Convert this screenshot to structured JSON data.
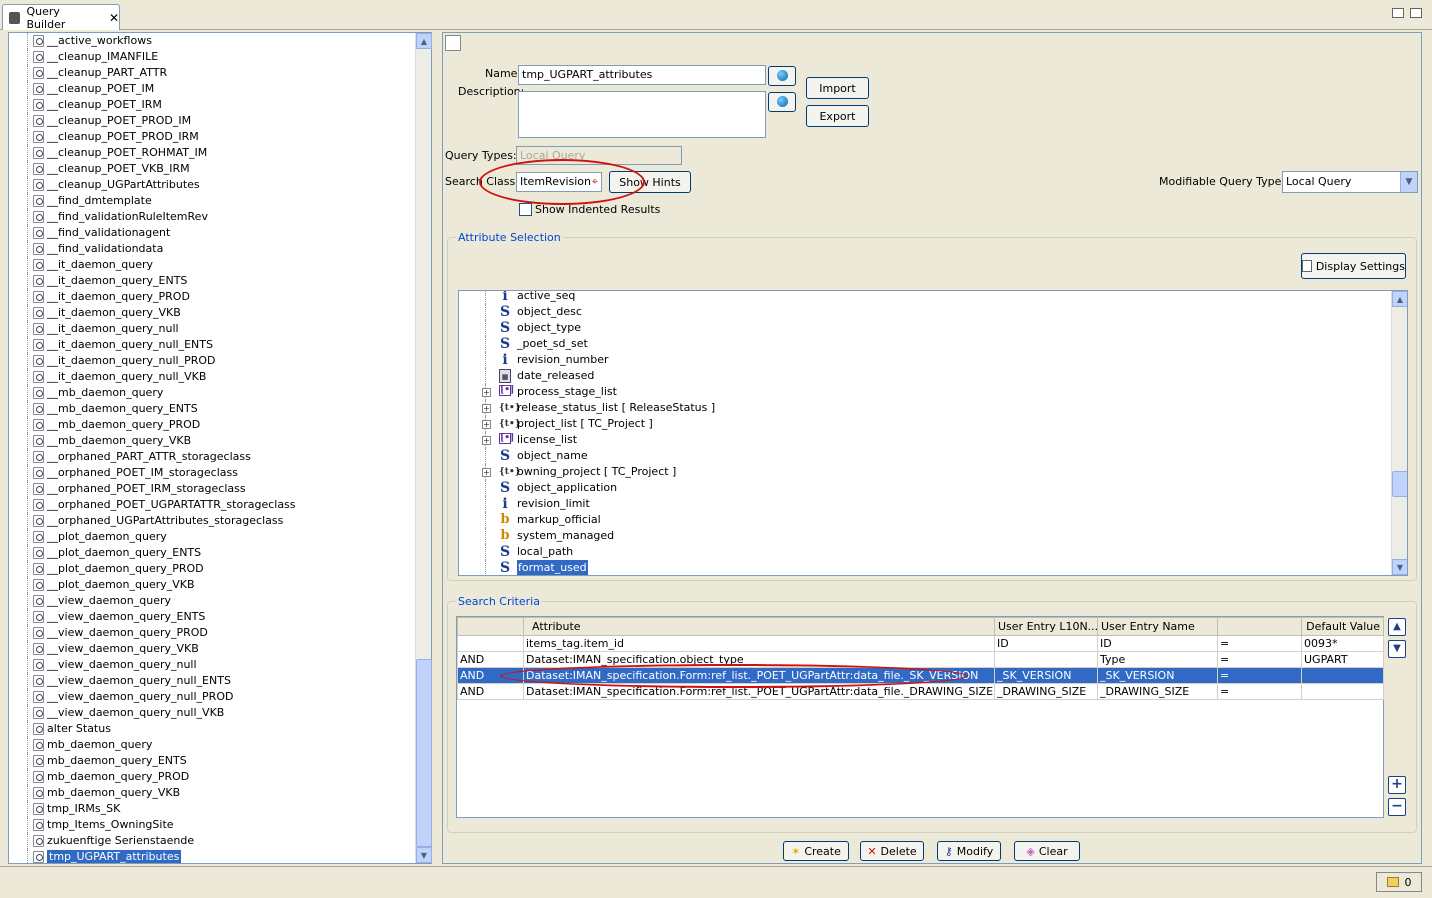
{
  "tab": {
    "title": "Query Builder"
  },
  "left_list": {
    "items": [
      "__active_workflows",
      "__cleanup_IMANFILE",
      "__cleanup_PART_ATTR",
      "__cleanup_POET_IM",
      "__cleanup_POET_IRM",
      "__cleanup_POET_PROD_IM",
      "__cleanup_POET_PROD_IRM",
      "__cleanup_POET_ROHMAT_IM",
      "__cleanup_POET_VKB_IRM",
      "__cleanup_UGPartAttributes",
      "__find_dmtemplate",
      "__find_validationRuleItemRev",
      "__find_validationagent",
      "__find_validationdata",
      "__it_daemon_query",
      "__it_daemon_query_ENTS",
      "__it_daemon_query_PROD",
      "__it_daemon_query_VKB",
      "__it_daemon_query_null",
      "__it_daemon_query_null_ENTS",
      "__it_daemon_query_null_PROD",
      "__it_daemon_query_null_VKB",
      "__mb_daemon_query",
      "__mb_daemon_query_ENTS",
      "__mb_daemon_query_PROD",
      "__mb_daemon_query_VKB",
      "__orphaned_PART_ATTR_storageclass",
      "__orphaned_POET_IM_storageclass",
      "__orphaned_POET_IRM_storageclass",
      "__orphaned_POET_UGPARTATTR_storageclass",
      "__orphaned_UGPartAttributes_storageclass",
      "__plot_daemon_query",
      "__plot_daemon_query_ENTS",
      "__plot_daemon_query_PROD",
      "__plot_daemon_query_VKB",
      "__view_daemon_query",
      "__view_daemon_query_ENTS",
      "__view_daemon_query_PROD",
      "__view_daemon_query_VKB",
      "__view_daemon_query_null",
      "__view_daemon_query_null_ENTS",
      "__view_daemon_query_null_PROD",
      "__view_daemon_query_null_VKB",
      "alter Status",
      "mb_daemon_query",
      "mb_daemon_query_ENTS",
      "mb_daemon_query_PROD",
      "mb_daemon_query_VKB",
      "tmp_IRMs_SK",
      "tmp_Items_OwningSite",
      "zukuenftige Serienstaende",
      "tmp_UGPART_attributes"
    ],
    "selected_index": 51
  },
  "form": {
    "name_label": "Name:",
    "name_value": "tmp_UGPART_attributes",
    "description_label": "Description:",
    "description_value": "",
    "import_label": "Import",
    "export_label": "Export",
    "query_types_label": "Query Types:",
    "query_types_value": "Local Query",
    "search_class_label": "Search Class:",
    "search_class_value": "ItemRevision",
    "show_hints_label": "Show Hints",
    "show_indented_label": "Show Indented Results",
    "modifiable_label": "Modifiable Query Types:",
    "modifiable_value": "Local Query"
  },
  "attribute_selection": {
    "title": "Attribute Selection",
    "display_settings_label": "Display Settings",
    "items": [
      {
        "icon": "i",
        "label": "active_seq",
        "expandable": false
      },
      {
        "icon": "S",
        "label": "object_desc",
        "expandable": false
      },
      {
        "icon": "S",
        "label": "object_type",
        "expandable": false
      },
      {
        "icon": "S",
        "label": "_poet_sd_set",
        "expandable": false
      },
      {
        "icon": "i",
        "label": "revision_number",
        "expandable": false
      },
      {
        "icon": "cal",
        "label": "date_released",
        "expandable": false
      },
      {
        "icon": "arr",
        "label": "process_stage_list",
        "expandable": true
      },
      {
        "icon": "ref",
        "label": "release_status_list [ ReleaseStatus ]",
        "expandable": true
      },
      {
        "icon": "ref",
        "label": "project_list [ TC_Project ]",
        "expandable": true
      },
      {
        "icon": "arr",
        "label": "license_list",
        "expandable": true
      },
      {
        "icon": "S",
        "label": "object_name",
        "expandable": false
      },
      {
        "icon": "ref",
        "label": "owning_project [ TC_Project ]",
        "expandable": true
      },
      {
        "icon": "S",
        "label": "object_application",
        "expandable": false
      },
      {
        "icon": "i",
        "label": "revision_limit",
        "expandable": false
      },
      {
        "icon": "b",
        "label": "markup_official",
        "expandable": false
      },
      {
        "icon": "b",
        "label": "system_managed",
        "expandable": false
      },
      {
        "icon": "S",
        "label": "local_path",
        "expandable": false
      },
      {
        "icon": "S",
        "label": "format_used",
        "expandable": false
      }
    ],
    "selected_index": 17
  },
  "search_criteria": {
    "title": "Search Criteria",
    "columns": [
      "",
      "Attribute",
      "User Entry L10N...",
      "User Entry Name",
      "",
      "Default Value"
    ],
    "rows": [
      [
        "",
        "items_tag.item_id",
        "ID",
        "ID",
        "=",
        "0093*"
      ],
      [
        "AND",
        "Dataset:IMAN_specification.object_type",
        "",
        "Type",
        "=",
        "UGPART"
      ],
      [
        "AND",
        "Dataset:IMAN_specification.Form:ref_list._POET_UGPartAttr:data_file._SK_VERSION",
        "_SK_VERSION",
        "_SK_VERSION",
        "=",
        ""
      ],
      [
        "AND",
        "Dataset:IMAN_specification.Form:ref_list._POET_UGPartAttr:data_file._DRAWING_SIZE",
        "_DRAWING_SIZE",
        "_DRAWING_SIZE",
        "=",
        ""
      ]
    ],
    "selected_row": 2
  },
  "bottom_buttons": {
    "create": "Create",
    "delete": "Delete",
    "modify": "Modify",
    "clear": "Clear"
  },
  "status": {
    "count": "0"
  },
  "colors": {
    "selection": "#316ac5",
    "highlight_ellipse": "#d01010",
    "group_title": "#0046d5"
  }
}
